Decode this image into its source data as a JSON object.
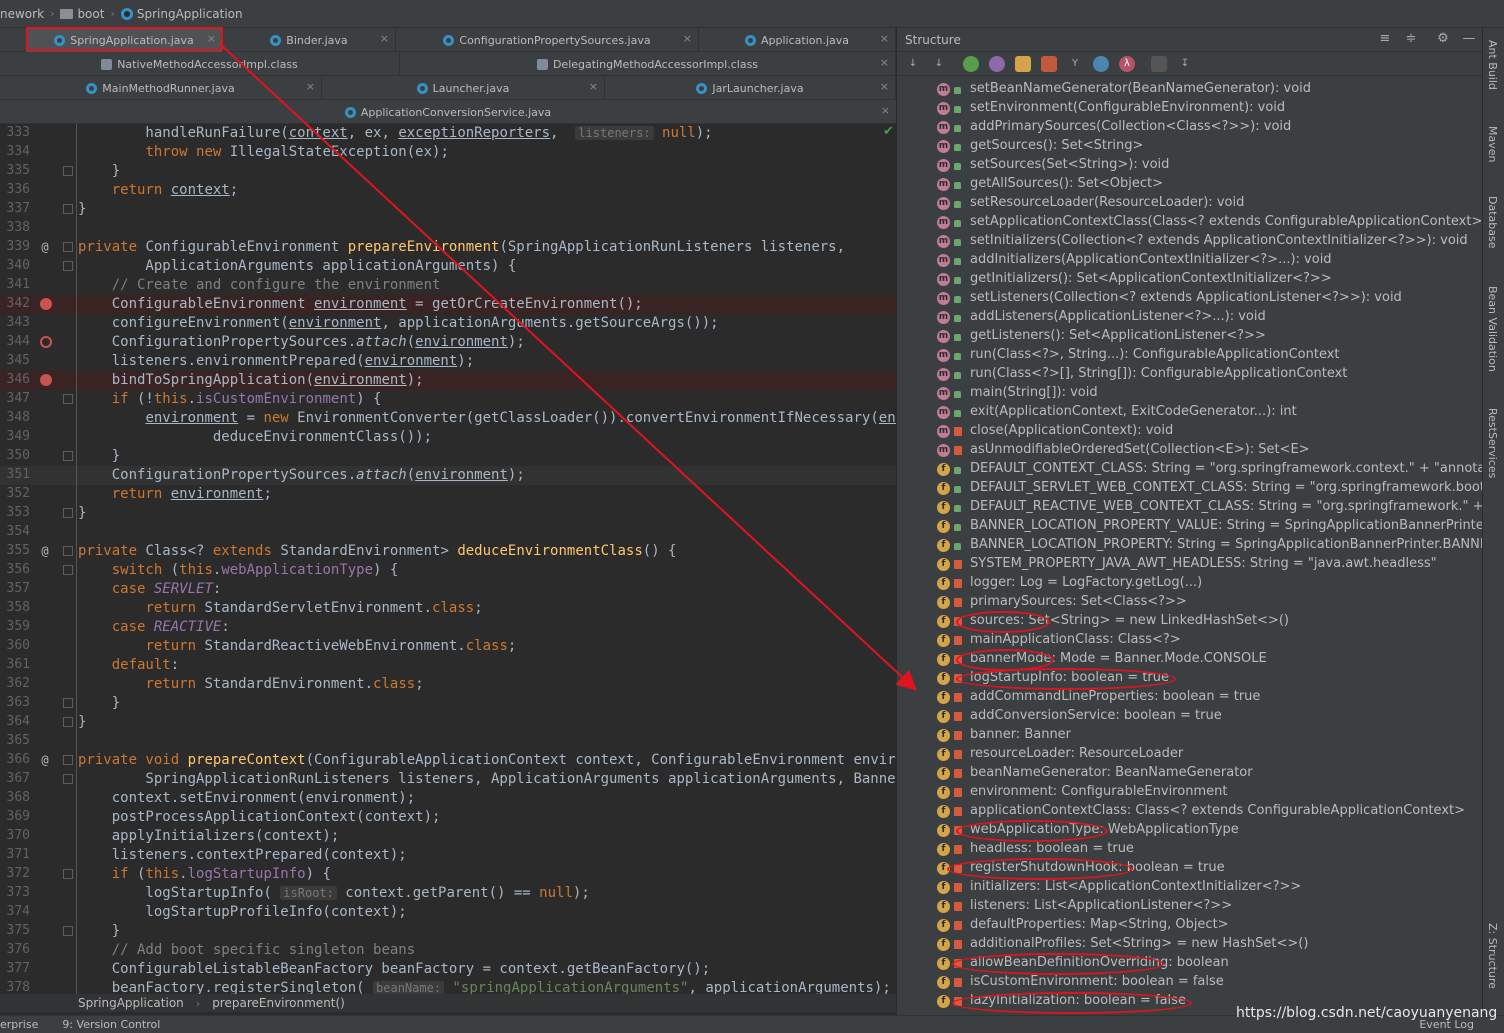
{
  "breadcrumb": [
    "nework",
    "boot",
    "SpringApplication"
  ],
  "tabs": {
    "row1": [
      "SpringApplication.java",
      "Binder.java",
      "ConfigurationPropertySources.java",
      "Application.java"
    ],
    "row2": [
      "NativeMethodAccessorImpl.class",
      "DelegatingMethodAccessorImpl.class"
    ],
    "row3": [
      "MainMethodRunner.java",
      "Launcher.java",
      "JarLauncher.java"
    ],
    "row4": [
      "ApplicationConversionService.java"
    ],
    "close": "×"
  },
  "structure": {
    "title": "Structure",
    "members": [
      {
        "kind": "m",
        "access": "pub",
        "text": "setBeanNameGenerator(BeanNameGenerator): void"
      },
      {
        "kind": "m",
        "access": "pub",
        "text": "setEnvironment(ConfigurableEnvironment): void"
      },
      {
        "kind": "m",
        "access": "pub",
        "text": "addPrimarySources(Collection<Class<?>>): void"
      },
      {
        "kind": "m",
        "access": "pub",
        "text": "getSources(): Set<String>"
      },
      {
        "kind": "m",
        "access": "pub",
        "text": "setSources(Set<String>): void"
      },
      {
        "kind": "m",
        "access": "pub",
        "text": "getAllSources(): Set<Object>"
      },
      {
        "kind": "m",
        "access": "pub",
        "text": "setResourceLoader(ResourceLoader): void"
      },
      {
        "kind": "m",
        "access": "pub",
        "text": "setApplicationContextClass(Class<? extends ConfigurableApplicationContext>): v"
      },
      {
        "kind": "m",
        "access": "pub",
        "text": "setInitializers(Collection<? extends ApplicationContextInitializer<?>>): void"
      },
      {
        "kind": "m",
        "access": "pub",
        "text": "addInitializers(ApplicationContextInitializer<?>...): void"
      },
      {
        "kind": "m",
        "access": "pub",
        "text": "getInitializers(): Set<ApplicationContextInitializer<?>>"
      },
      {
        "kind": "m",
        "access": "pub",
        "text": "setListeners(Collection<? extends ApplicationListener<?>>): void"
      },
      {
        "kind": "m",
        "access": "pub",
        "text": "addListeners(ApplicationListener<?>...): void"
      },
      {
        "kind": "m",
        "access": "pub",
        "text": "getListeners(): Set<ApplicationListener<?>>"
      },
      {
        "kind": "m",
        "access": "pub",
        "text": "run(Class<?>, String...): ConfigurableApplicationContext"
      },
      {
        "kind": "m",
        "access": "pub",
        "text": "run(Class<?>[], String[]): ConfigurableApplicationContext"
      },
      {
        "kind": "m",
        "access": "pub",
        "text": "main(String[]): void"
      },
      {
        "kind": "m",
        "access": "pub",
        "text": "exit(ApplicationContext, ExitCodeGenerator...): int"
      },
      {
        "kind": "m",
        "access": "pri",
        "text": "close(ApplicationContext): void"
      },
      {
        "kind": "m",
        "access": "pri",
        "text": "asUnmodifiableOrderedSet(Collection<E>): Set<E>"
      },
      {
        "kind": "f",
        "access": "pub",
        "text": "DEFAULT_CONTEXT_CLASS: String = \"org.springframework.context.\" + \"annotatio"
      },
      {
        "kind": "f",
        "access": "pub",
        "text": "DEFAULT_SERVLET_WEB_CONTEXT_CLASS: String = \"org.springframework.boot.\" +"
      },
      {
        "kind": "f",
        "access": "pub",
        "text": "DEFAULT_REACTIVE_WEB_CONTEXT_CLASS: String = \"org.springframework.\" + \"bo"
      },
      {
        "kind": "f",
        "access": "pub",
        "text": "BANNER_LOCATION_PROPERTY_VALUE: String = SpringApplicationBannerPrinter.D"
      },
      {
        "kind": "f",
        "access": "pub",
        "text": "BANNER_LOCATION_PROPERTY: String = SpringApplicationBannerPrinter.BANNER_"
      },
      {
        "kind": "f",
        "access": "pri",
        "text": "SYSTEM_PROPERTY_JAVA_AWT_HEADLESS: String = \"java.awt.headless\""
      },
      {
        "kind": "f",
        "access": "pri",
        "text": "logger: Log = LogFactory.getLog(...)"
      },
      {
        "kind": "f",
        "access": "pri",
        "text": "primarySources: Set<Class<?>>"
      },
      {
        "kind": "f",
        "access": "pri",
        "text": "sources: Set<String> = new LinkedHashSet<>()"
      },
      {
        "kind": "f",
        "access": "pri",
        "text": "mainApplicationClass: Class<?>"
      },
      {
        "kind": "f",
        "access": "pri",
        "text": "bannerMode: Mode = Banner.Mode.CONSOLE"
      },
      {
        "kind": "f",
        "access": "pri",
        "text": "logStartupInfo: boolean = true"
      },
      {
        "kind": "f",
        "access": "pri",
        "text": "addCommandLineProperties: boolean = true"
      },
      {
        "kind": "f",
        "access": "pri",
        "text": "addConversionService: boolean = true"
      },
      {
        "kind": "f",
        "access": "pri",
        "text": "banner: Banner"
      },
      {
        "kind": "f",
        "access": "pri",
        "text": "resourceLoader: ResourceLoader"
      },
      {
        "kind": "f",
        "access": "pri",
        "text": "beanNameGenerator: BeanNameGenerator"
      },
      {
        "kind": "f",
        "access": "pri",
        "text": "environment: ConfigurableEnvironment"
      },
      {
        "kind": "f",
        "access": "pri",
        "text": "applicationContextClass: Class<? extends ConfigurableApplicationContext>"
      },
      {
        "kind": "f",
        "access": "pri",
        "text": "webApplicationType: WebApplicationType"
      },
      {
        "kind": "f",
        "access": "pri",
        "text": "headless: boolean = true"
      },
      {
        "kind": "f",
        "access": "pri",
        "text": "registerShutdownHook: boolean = true"
      },
      {
        "kind": "f",
        "access": "pri",
        "text": "initializers: List<ApplicationContextInitializer<?>>"
      },
      {
        "kind": "f",
        "access": "pri",
        "text": "listeners: List<ApplicationListener<?>>"
      },
      {
        "kind": "f",
        "access": "pri",
        "text": "defaultProperties: Map<String, Object>"
      },
      {
        "kind": "f",
        "access": "pri",
        "text": "additionalProfiles: Set<String> = new HashSet<>()"
      },
      {
        "kind": "f",
        "access": "pri",
        "text": "allowBeanDefinitionOverriding: boolean"
      },
      {
        "kind": "f",
        "access": "pri",
        "text": "isCustomEnvironment: boolean = false"
      },
      {
        "kind": "f",
        "access": "pri",
        "text": "lazyInitialization: boolean = false"
      }
    ]
  },
  "editor": {
    "lines": [
      {
        "n": "333",
        "gutter": "",
        "html": "        handleRunFailure(<span class='ul'>context</span>, ex, <span class='ul'>exceptionReporters</span>,  <span class='hint'>listeners:</span> <span class='kw'>null</span>);"
      },
      {
        "n": "334",
        "gutter": "",
        "html": "        <span class='kw'>throw new</span> IllegalStateException(ex);"
      },
      {
        "n": "335",
        "gutter": "fold",
        "html": "    }"
      },
      {
        "n": "336",
        "gutter": "",
        "html": "    <span class='kw'>return</span> <span class='ul'>context</span>;"
      },
      {
        "n": "337",
        "gutter": "fold",
        "html": "}"
      },
      {
        "n": "338",
        "gutter": "",
        "html": ""
      },
      {
        "n": "339",
        "gutter": "at",
        "html": "<span class='kw'>private</span> ConfigurableEnvironment <span class='fn'>prepareEnvironment</span>(SpringApplicationRunListeners listeners,"
      },
      {
        "n": "340",
        "gutter": "fold",
        "html": "        ApplicationArguments applicationArguments) {"
      },
      {
        "n": "341",
        "gutter": "",
        "html": "    <span class='cm'>// Create and configure the environment</span>"
      },
      {
        "n": "342",
        "gutter": "bp",
        "html": "    ConfigurableEnvironment <span class='ul'>environment</span> = getOrCreateEnvironment();"
      },
      {
        "n": "343",
        "gutter": "",
        "html": "    configureEnvironment(<span class='ul'>environment</span>, applicationArguments.getSourceArgs());"
      },
      {
        "n": "344",
        "gutter": "bpe",
        "html": "    ConfigurationPropertySources.<span class='it'>attach</span>(<span class='ul'>environment</span>);"
      },
      {
        "n": "345",
        "gutter": "",
        "html": "    listeners.environmentPrepared(<span class='ul'>environment</span>);"
      },
      {
        "n": "346",
        "gutter": "bp",
        "html": "    bindToSpringApplication(<span class='ul'>environment</span>);"
      },
      {
        "n": "347",
        "gutter": "fold",
        "html": "    <span class='kw'>if</span> (!<span class='kw'>this</span>.<span class='fld'>isCustomEnvironment</span>) {"
      },
      {
        "n": "348",
        "gutter": "",
        "html": "        <span class='ul'>environment</span> = <span class='kw'>new</span> EnvironmentConverter(getClassLoader()).convertEnvironmentIfNecessary(<span class='ul'>envi</span>"
      },
      {
        "n": "349",
        "gutter": "",
        "html": "                deduceEnvironmentClass());"
      },
      {
        "n": "350",
        "gutter": "fold",
        "html": "    }"
      },
      {
        "n": "351",
        "gutter": "",
        "html": "    ConfigurationPropertySources.<span class='it'>attach</span>(<span class='ul'>environment</span>);"
      },
      {
        "n": "352",
        "gutter": "",
        "html": "    <span class='kw'>return</span> <span class='ul'>environment</span>;"
      },
      {
        "n": "353",
        "gutter": "fold",
        "html": "}"
      },
      {
        "n": "354",
        "gutter": "",
        "html": ""
      },
      {
        "n": "355",
        "gutter": "at",
        "html": "<span class='kw'>private</span> Class&lt;? <span class='kw'>extends</span> StandardEnvironment&gt; <span class='fn'>deduceEnvironmentClass</span>() {"
      },
      {
        "n": "356",
        "gutter": "fold",
        "html": "    <span class='kw'>switch</span> (<span class='kw'>this</span>.<span class='fld'>webApplicationType</span>) {"
      },
      {
        "n": "357",
        "gutter": "",
        "html": "    <span class='kw'>case</span> <span class='fld it'>SERVLET</span>:"
      },
      {
        "n": "358",
        "gutter": "",
        "html": "        <span class='kw'>return</span> StandardServletEnvironment.<span class='kw'>class</span>;"
      },
      {
        "n": "359",
        "gutter": "",
        "html": "    <span class='kw'>case</span> <span class='fld it'>REACTIVE</span>:"
      },
      {
        "n": "360",
        "gutter": "",
        "html": "        <span class='kw'>return</span> StandardReactiveWebEnvironment.<span class='kw'>class</span>;"
      },
      {
        "n": "361",
        "gutter": "",
        "html": "    <span class='kw'>default</span>:"
      },
      {
        "n": "362",
        "gutter": "",
        "html": "        <span class='kw'>return</span> StandardEnvironment.<span class='kw'>class</span>;"
      },
      {
        "n": "363",
        "gutter": "fold",
        "html": "    }"
      },
      {
        "n": "364",
        "gutter": "fold",
        "html": "}"
      },
      {
        "n": "365",
        "gutter": "",
        "html": ""
      },
      {
        "n": "366",
        "gutter": "at",
        "html": "<span class='kw'>private void</span> <span class='fn'>prepareContext</span>(ConfigurableApplicationContext context, ConfigurableEnvironment enviror"
      },
      {
        "n": "367",
        "gutter": "fold",
        "html": "        SpringApplicationRunListeners listeners, ApplicationArguments applicationArguments, Banner"
      },
      {
        "n": "368",
        "gutter": "",
        "html": "    context.setEnvironment(environment);"
      },
      {
        "n": "369",
        "gutter": "",
        "html": "    postProcessApplicationContext(context);"
      },
      {
        "n": "370",
        "gutter": "",
        "html": "    applyInitializers(context);"
      },
      {
        "n": "371",
        "gutter": "",
        "html": "    listeners.contextPrepared(context);"
      },
      {
        "n": "372",
        "gutter": "fold",
        "html": "    <span class='kw'>if</span> (<span class='kw'>this</span>.<span class='fld'>logStartupInfo</span>) {"
      },
      {
        "n": "373",
        "gutter": "",
        "html": "        logStartupInfo( <span class='hint'>isRoot:</span> context.getParent() == <span class='kw'>null</span>);"
      },
      {
        "n": "374",
        "gutter": "",
        "html": "        logStartupProfileInfo(context);"
      },
      {
        "n": "375",
        "gutter": "fold",
        "html": "    }"
      },
      {
        "n": "376",
        "gutter": "",
        "html": "    <span class='cm'>// Add boot specific singleton beans</span>"
      },
      {
        "n": "377",
        "gutter": "",
        "html": "    ConfigurableListableBeanFactory beanFactory = context.getBeanFactory();"
      },
      {
        "n": "378",
        "gutter": "",
        "html": "    beanFactory.registerSingleton( <span class='hint'>beanName:</span> <span class='str'>\"springApplicationArguments\"</span>, applicationArguments);"
      }
    ]
  },
  "editor_breadcrumb": [
    "SpringApplication",
    "prepareEnvironment()"
  ],
  "status": {
    "left": "erprise",
    "version_control": "9: Version Control",
    "event_log": "Event Log"
  },
  "right_strip": [
    "Ant Build",
    "Maven",
    "Database",
    "Bean Validation",
    "RestServices",
    "Z: Structure"
  ],
  "watermark": "https://blog.csdn.net/caoyuanyenang"
}
